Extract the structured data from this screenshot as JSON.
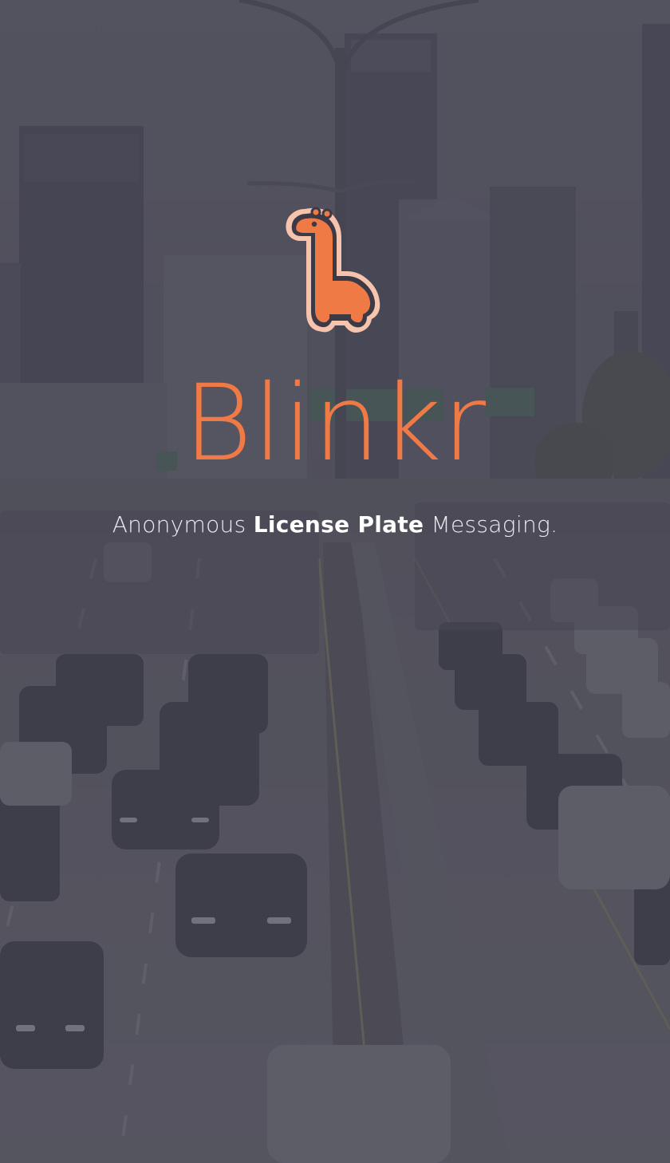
{
  "app": {
    "name": "Blinkr",
    "tagline_prefix": "Anonymous ",
    "tagline_emphasis": "License Plate",
    "tagline_suffix": " Messaging."
  },
  "logo": {
    "icon": "giraffe-icon",
    "color": "#f07a45",
    "outline_color": "#f6c3ad"
  },
  "background": {
    "scene": "highway-traffic-city-skyline",
    "tint": "#464454"
  }
}
